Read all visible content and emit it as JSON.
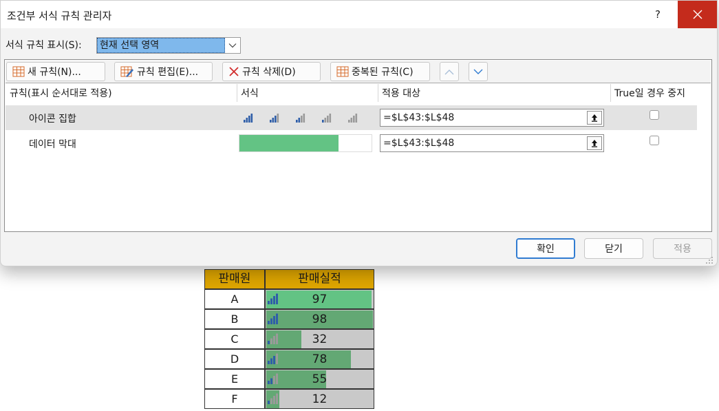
{
  "dialog": {
    "title": "조건부 서식 규칙 관리자",
    "help_label": "?",
    "show_rules_label": "서식 규칙 표시(S):",
    "show_rules_value": "현재 선택 영역",
    "toolbar": {
      "new_rule": "새 규칙(N)...",
      "edit_rule": "규칙 편집(E)...",
      "delete_rule": "규칙 삭제(D)",
      "duplicate_rule": "중복된 규칙(C)"
    },
    "columns": {
      "rule": "규칙(표시 순서대로 적용)",
      "format": "서식",
      "applies_to": "적용 대상",
      "stop_if_true": "True일 경우 중지"
    },
    "rules": [
      {
        "name": "아이콘 집합",
        "applies_to": "=$L$43:$L$48",
        "stop_if_true": false,
        "selected": true
      },
      {
        "name": "데이터 막대",
        "applies_to": "=$L$43:$L$48",
        "stop_if_true": false,
        "selected": false,
        "bar_fill_fraction": 0.75,
        "bar_color": "#63c384"
      }
    ],
    "buttons": {
      "ok": "확인",
      "close": "닫기",
      "apply": "적용"
    }
  },
  "table": {
    "header": {
      "seller": "판매원",
      "sales": "판매실적"
    },
    "header_color": "#dfa600",
    "rows": [
      {
        "seller": "A",
        "sales": "97",
        "value": 97
      },
      {
        "seller": "B",
        "sales": "98",
        "value": 98
      },
      {
        "seller": "C",
        "sales": "32",
        "value": 32
      },
      {
        "seller": "D",
        "sales": "78",
        "value": 78
      },
      {
        "seller": "E",
        "sales": "55",
        "value": 55
      },
      {
        "seller": "F",
        "sales": "12",
        "value": 12
      }
    ]
  },
  "colors": {
    "close_red": "#c42b1c",
    "databar_green": "#63a874",
    "icon_blue": "#2f5ea8",
    "icon_gray": "#9a9a9a"
  },
  "icons": [
    "close-icon",
    "new-rule-icon",
    "edit-rule-icon",
    "delete-x-icon",
    "duplicate-rule-icon",
    "move-up-icon",
    "move-down-icon",
    "collapse-range-icon",
    "signal-bars-icon"
  ]
}
